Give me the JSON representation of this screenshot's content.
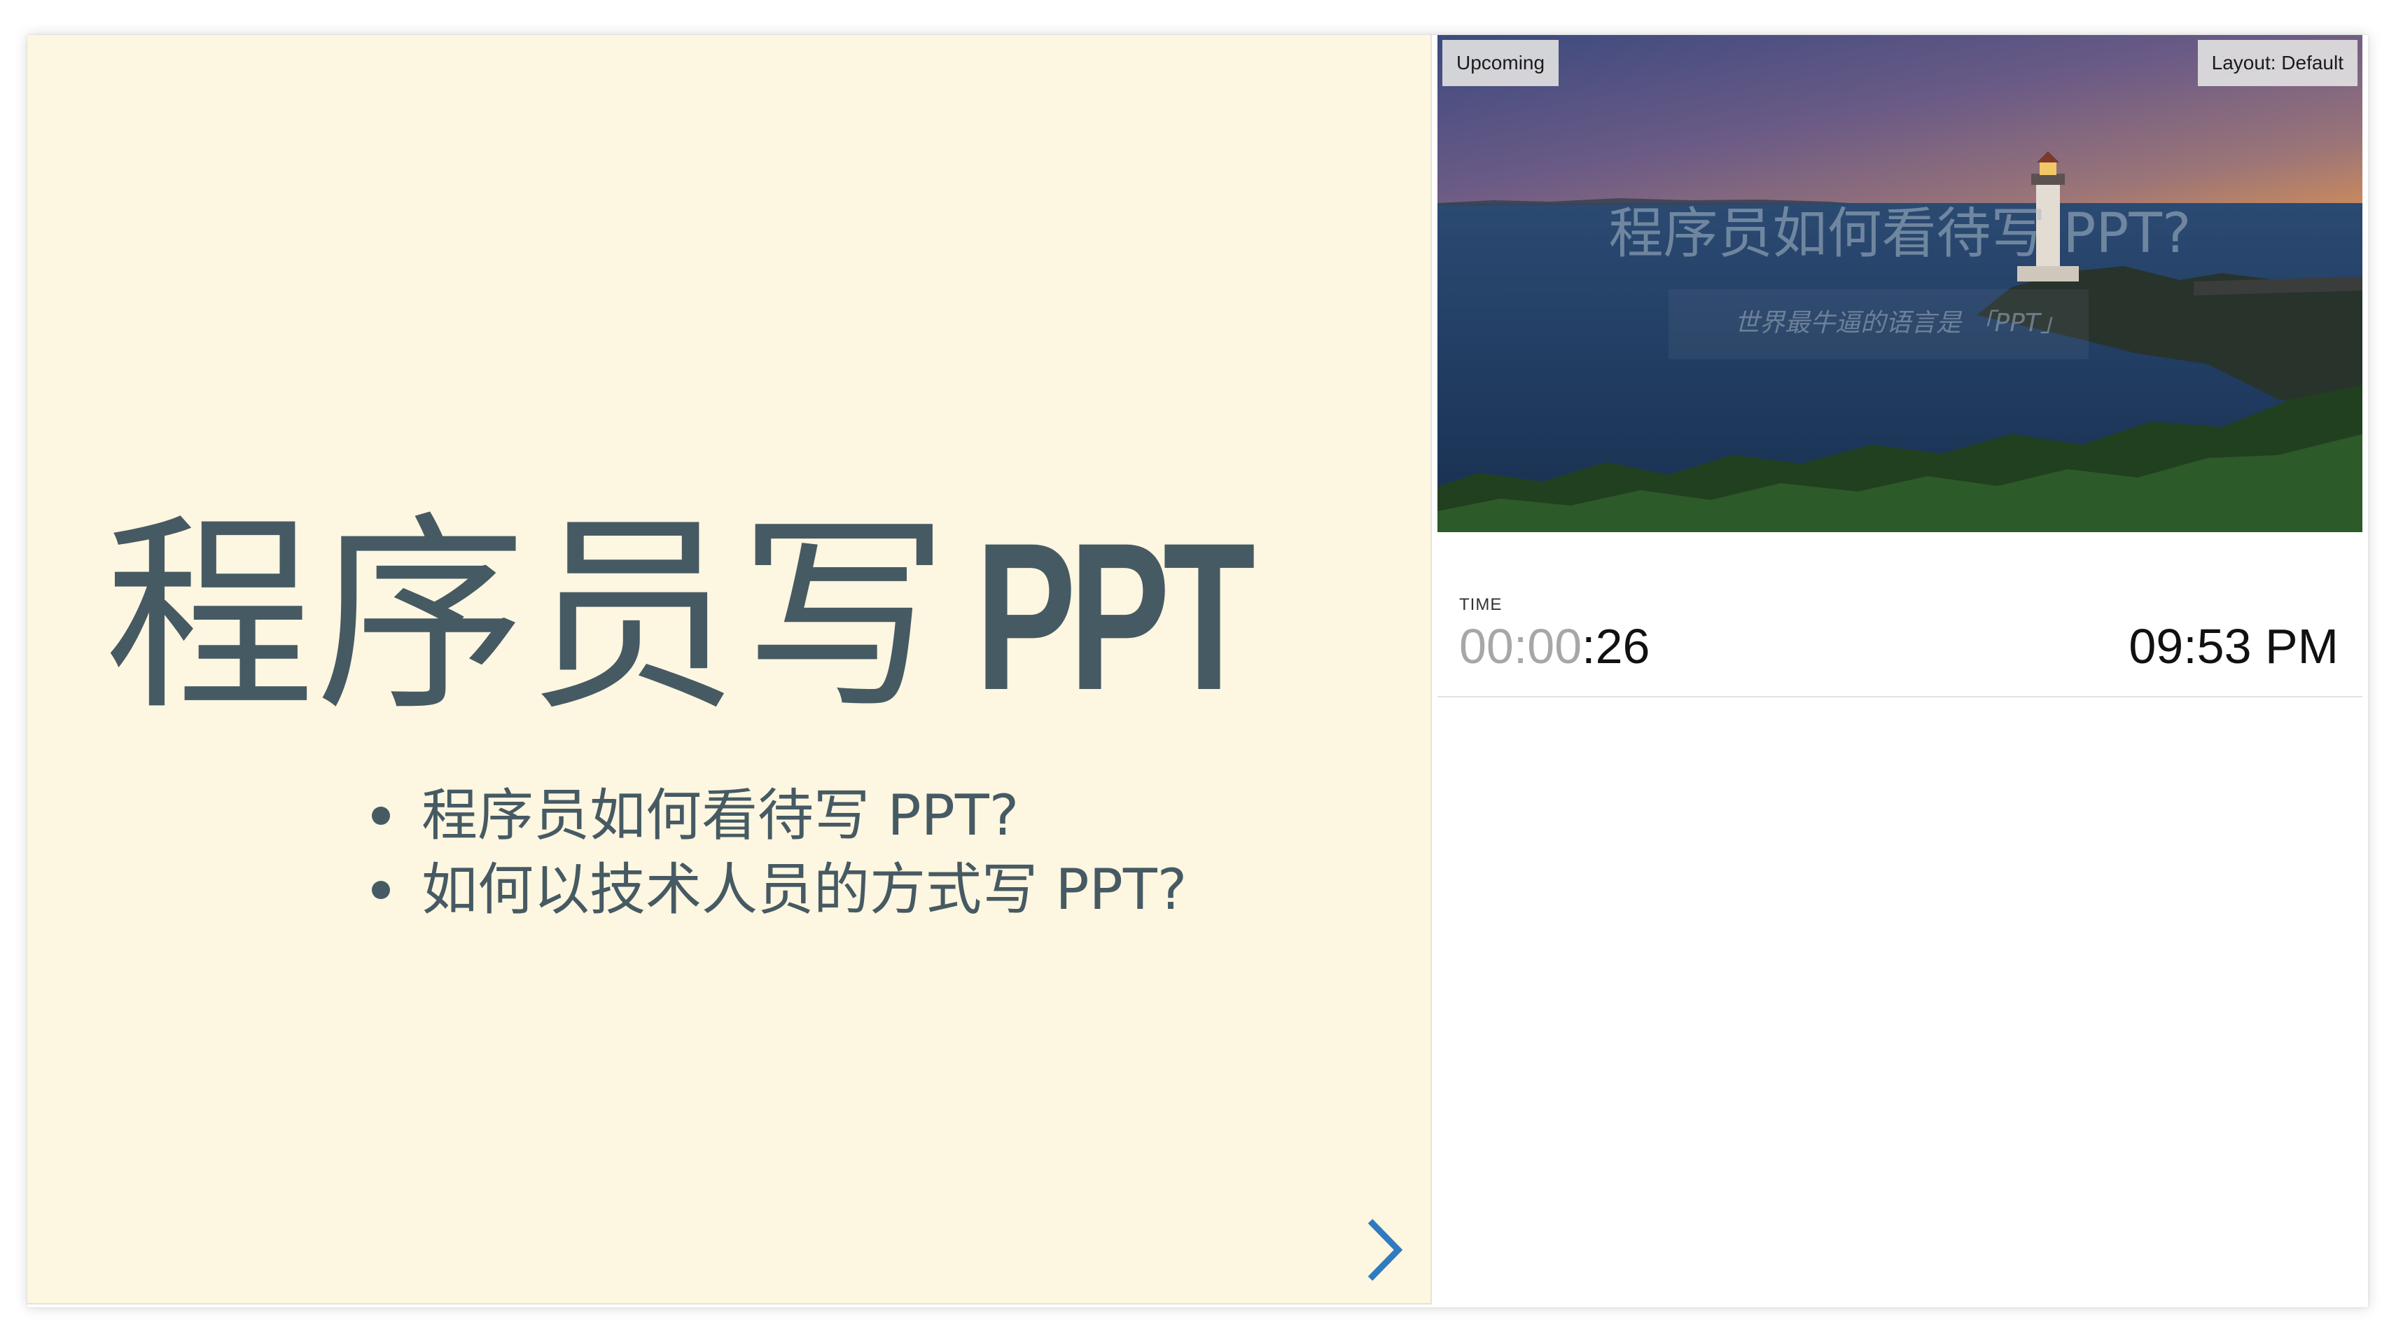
{
  "colors": {
    "slide_background": "#fdf6e0",
    "slide_text": "#465a63",
    "nav_arrow": "#2f7bbf",
    "timer_elapsed_dim": "#a7a7a7"
  },
  "current_slide": {
    "title_cjk": "程序员写",
    "title_latin": "PPT",
    "bullets": [
      "程序员如何看待写 PPT?",
      "如何以技术人员的方式写 PPT?"
    ],
    "next_icon": "chevron-right-icon"
  },
  "upcoming": {
    "label": "Upcoming",
    "layout_label": "Layout: Default",
    "title": "程序员如何看待写 PPT?",
    "subtitle": "世界最牛逼的语言是 「PPT」"
  },
  "timer": {
    "label": "TIME",
    "elapsed_dim": "00:00",
    "elapsed_lit": ":26",
    "clock": "09:53 PM"
  }
}
